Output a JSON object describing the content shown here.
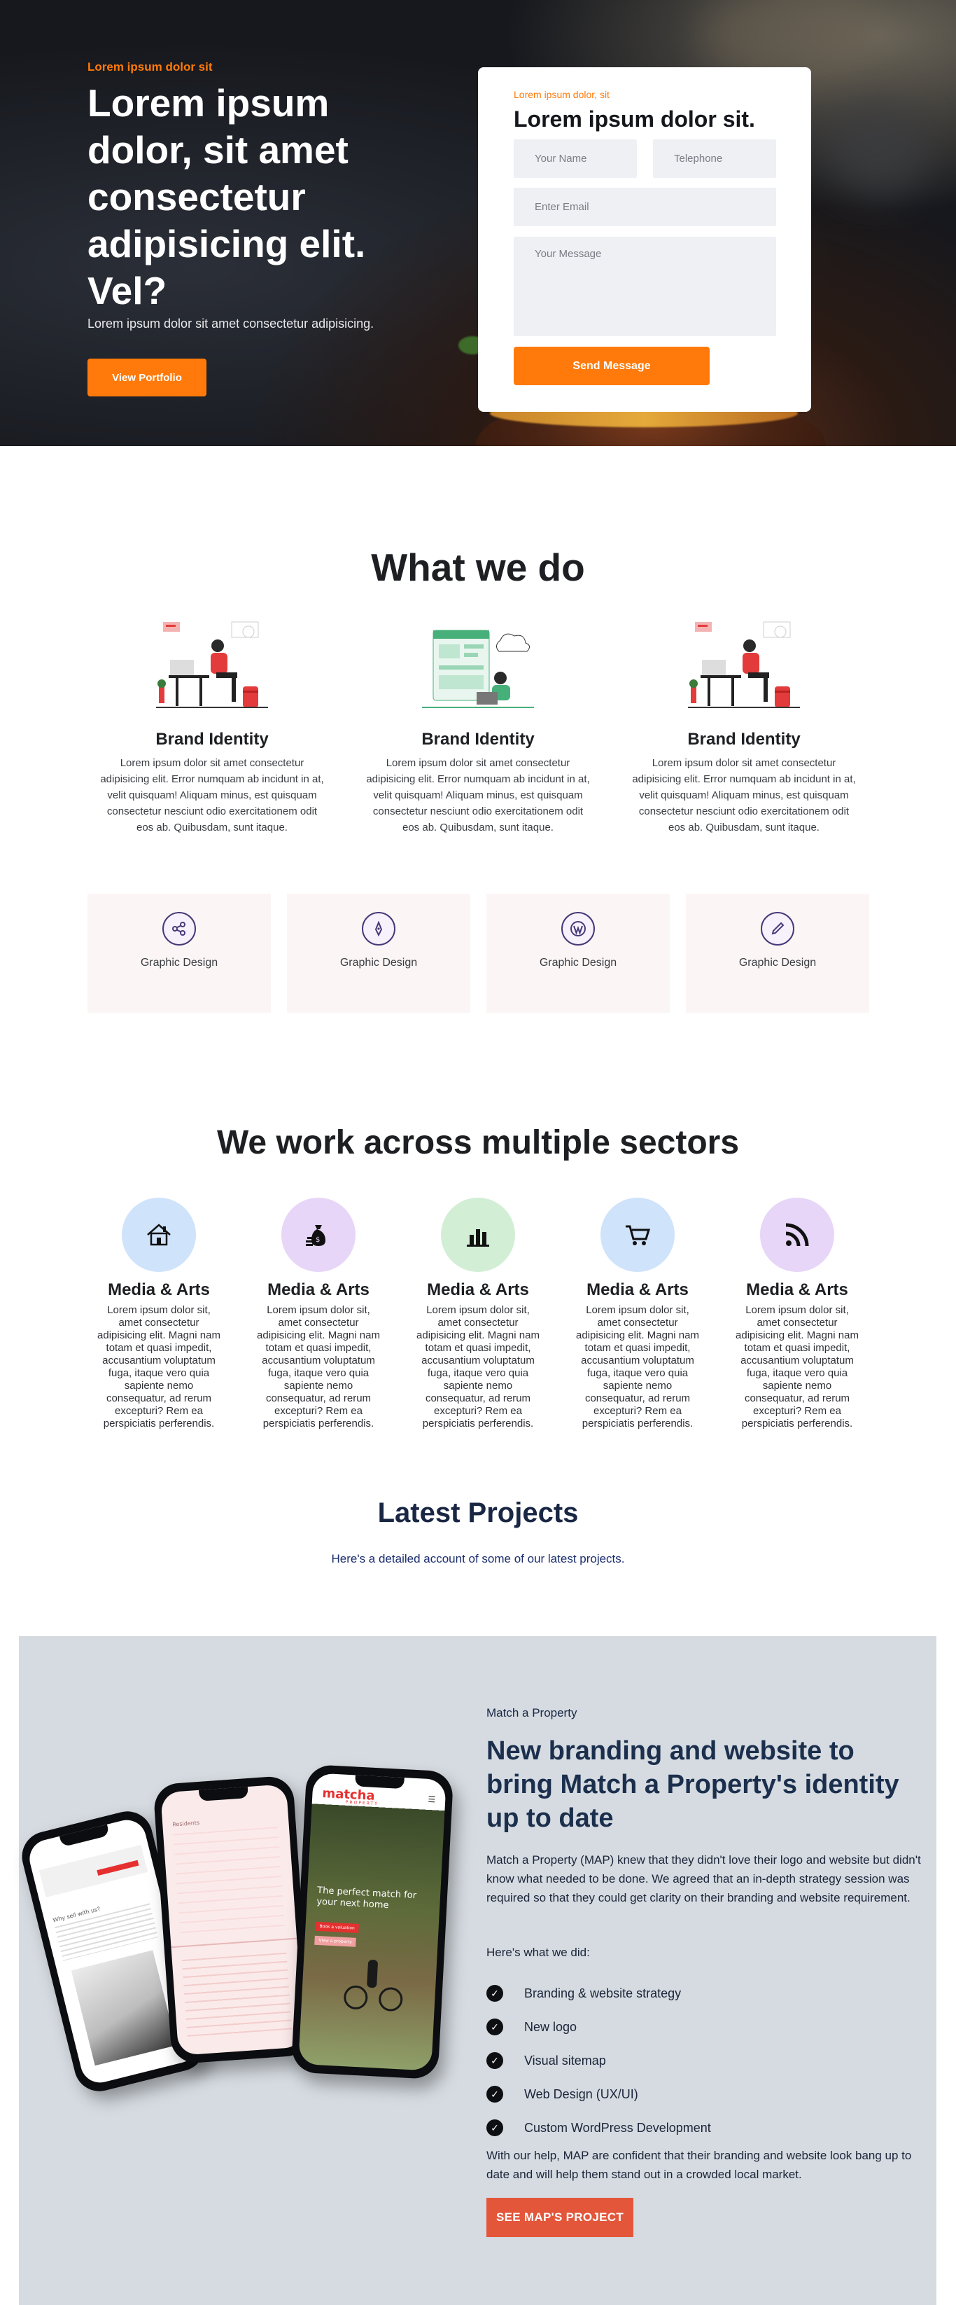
{
  "hero": {
    "tag": "Lorem ipsum dolor sit",
    "title": "Lorem ipsum dolor, sit amet consectetur adipisicing elit. Vel?",
    "subtitle": "Lorem ipsum dolor sit amet consectetur adipisicing.",
    "button": "View Portfolio"
  },
  "form": {
    "tag": "Lorem ipsum dolor, sit",
    "title": "Lorem ipsum dolor sit.",
    "name_placeholder": "Your Name",
    "phone_placeholder": "Telephone",
    "email_placeholder": "Enter Email",
    "message_placeholder": "Your Message",
    "button": "Send Message"
  },
  "what_we_do": {
    "title": "What we do",
    "services": [
      {
        "title": "Brand Identity",
        "text": "Lorem ipsum dolor sit amet consectetur adipisicing elit. Error numquam ab incidunt in at, velit quisquam! Aliquam minus, est quisquam consectetur nesciunt odio exercitationem odit eos ab. Quibusdam, sunt itaque."
      },
      {
        "title": "Brand Identity",
        "text": "Lorem ipsum dolor sit amet consectetur adipisicing elit. Error numquam ab incidunt in at, velit quisquam! Aliquam minus, est quisquam consectetur nesciunt odio exercitationem odit eos ab. Quibusdam, sunt itaque."
      },
      {
        "title": "Brand Identity",
        "text": "Lorem ipsum dolor sit amet consectetur adipisicing elit. Error numquam ab incidunt in at, velit quisquam! Aliquam minus, est quisquam consectetur nesciunt odio exercitationem odit eos ab. Quibusdam, sunt itaque."
      }
    ],
    "tiles": [
      {
        "label": "Graphic Design",
        "icon": "share-nodes-icon"
      },
      {
        "label": "Graphic Design",
        "icon": "pen-nib-icon"
      },
      {
        "label": "Graphic Design",
        "icon": "wordpress-icon"
      },
      {
        "label": "Graphic Design",
        "icon": "pen-icon"
      }
    ]
  },
  "sectors": {
    "title": "We work across multiple sectors",
    "items": [
      {
        "title": "Media & Arts",
        "text": "Lorem ipsum dolor sit, amet consectetur adipisicing elit. Magni nam totam et quasi impedit, accusantium voluptatum fuga, itaque vero quia sapiente nemo consequatur, ad rerum excepturi? Rem ea perspiciatis perferendis.",
        "icon": "house-icon",
        "color": "#cfe3fb"
      },
      {
        "title": "Media & Arts",
        "text": "Lorem ipsum dolor sit, amet consectetur adipisicing elit. Magni nam totam et quasi impedit, accusantium voluptatum fuga, itaque vero quia sapiente nemo consequatur, ad rerum excepturi? Rem ea perspiciatis perferendis.",
        "icon": "money-bag-icon",
        "color": "#e7d6f7"
      },
      {
        "title": "Media & Arts",
        "text": "Lorem ipsum dolor sit, amet consectetur adipisicing elit. Magni nam totam et quasi impedit, accusantium voluptatum fuga, itaque vero quia sapiente nemo consequatur, ad rerum excepturi? Rem ea perspiciatis perferendis.",
        "icon": "bar-chart-icon",
        "color": "#d2efd6"
      },
      {
        "title": "Media & Arts",
        "text": "Lorem ipsum dolor sit, amet consectetur adipisicing elit. Magni nam totam et quasi impedit, accusantium voluptatum fuga, itaque vero quia sapiente nemo consequatur, ad rerum excepturi? Rem ea perspiciatis perferendis.",
        "icon": "shopping-cart-icon",
        "color": "#cfe3fb"
      },
      {
        "title": "Media & Arts",
        "text": "Lorem ipsum dolor sit, amet consectetur adipisicing elit. Magni nam totam et quasi impedit, accusantium voluptatum fuga, itaque vero quia sapiente nemo consequatur, ad rerum excepturi? Rem ea perspiciatis perferendis.",
        "icon": "rss-icon",
        "color": "#e7d6f7"
      }
    ]
  },
  "projects": {
    "title": "Latest Projects",
    "subtitle": "Here's a detailed account of some of our latest projects.",
    "client": "Match a Property",
    "headline": "New branding and website to bring Match a Property's identity up to date",
    "body": "Match a Property (MAP) knew that they didn't love their logo and website but didn't know what needed to be done. We agreed that an in-depth strategy session was required so that they could get clarity on their branding and website requirement.",
    "did_label": "Here's what we did:",
    "deliverables": [
      "Branding & website strategy",
      "New logo",
      "Visual sitemap",
      "Web Design (UX/UI)",
      "Custom WordPress Development"
    ],
    "footer": "With our help, MAP are confident that their branding and website look bang up to date and will help them stand out in a crowded local market.",
    "button": "SEE MAP'S PROJECT",
    "phone_brand": "matcha",
    "phone_brand_sub": "PROPERTY",
    "phone_tagline": "The perfect match for your next home",
    "phone_btn1": "Book a valuation",
    "phone_btn2": "View a property",
    "phone_side_title": "Why sell with us?",
    "phone_mid_title": "Residents"
  },
  "colors": {
    "accent": "#ff7a0a",
    "heading": "#1d1f23",
    "project_bg": "#d5dbe1",
    "project_button": "#e4563a"
  }
}
